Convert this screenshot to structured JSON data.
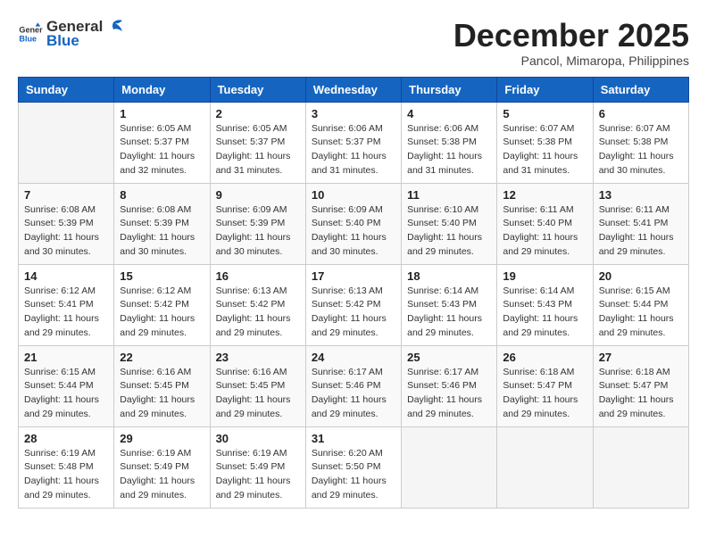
{
  "header": {
    "logo_general": "General",
    "logo_blue": "Blue",
    "month_year": "December 2025",
    "location": "Pancol, Mimaropa, Philippines"
  },
  "weekdays": [
    "Sunday",
    "Monday",
    "Tuesday",
    "Wednesday",
    "Thursday",
    "Friday",
    "Saturday"
  ],
  "weeks": [
    [
      {
        "day": "",
        "sunrise": "",
        "sunset": "",
        "daylight": ""
      },
      {
        "day": "1",
        "sunrise": "Sunrise: 6:05 AM",
        "sunset": "Sunset: 5:37 PM",
        "daylight": "Daylight: 11 hours and 32 minutes."
      },
      {
        "day": "2",
        "sunrise": "Sunrise: 6:05 AM",
        "sunset": "Sunset: 5:37 PM",
        "daylight": "Daylight: 11 hours and 31 minutes."
      },
      {
        "day": "3",
        "sunrise": "Sunrise: 6:06 AM",
        "sunset": "Sunset: 5:37 PM",
        "daylight": "Daylight: 11 hours and 31 minutes."
      },
      {
        "day": "4",
        "sunrise": "Sunrise: 6:06 AM",
        "sunset": "Sunset: 5:38 PM",
        "daylight": "Daylight: 11 hours and 31 minutes."
      },
      {
        "day": "5",
        "sunrise": "Sunrise: 6:07 AM",
        "sunset": "Sunset: 5:38 PM",
        "daylight": "Daylight: 11 hours and 31 minutes."
      },
      {
        "day": "6",
        "sunrise": "Sunrise: 6:07 AM",
        "sunset": "Sunset: 5:38 PM",
        "daylight": "Daylight: 11 hours and 30 minutes."
      }
    ],
    [
      {
        "day": "7",
        "sunrise": "Sunrise: 6:08 AM",
        "sunset": "Sunset: 5:39 PM",
        "daylight": "Daylight: 11 hours and 30 minutes."
      },
      {
        "day": "8",
        "sunrise": "Sunrise: 6:08 AM",
        "sunset": "Sunset: 5:39 PM",
        "daylight": "Daylight: 11 hours and 30 minutes."
      },
      {
        "day": "9",
        "sunrise": "Sunrise: 6:09 AM",
        "sunset": "Sunset: 5:39 PM",
        "daylight": "Daylight: 11 hours and 30 minutes."
      },
      {
        "day": "10",
        "sunrise": "Sunrise: 6:09 AM",
        "sunset": "Sunset: 5:40 PM",
        "daylight": "Daylight: 11 hours and 30 minutes."
      },
      {
        "day": "11",
        "sunrise": "Sunrise: 6:10 AM",
        "sunset": "Sunset: 5:40 PM",
        "daylight": "Daylight: 11 hours and 29 minutes."
      },
      {
        "day": "12",
        "sunrise": "Sunrise: 6:11 AM",
        "sunset": "Sunset: 5:40 PM",
        "daylight": "Daylight: 11 hours and 29 minutes."
      },
      {
        "day": "13",
        "sunrise": "Sunrise: 6:11 AM",
        "sunset": "Sunset: 5:41 PM",
        "daylight": "Daylight: 11 hours and 29 minutes."
      }
    ],
    [
      {
        "day": "14",
        "sunrise": "Sunrise: 6:12 AM",
        "sunset": "Sunset: 5:41 PM",
        "daylight": "Daylight: 11 hours and 29 minutes."
      },
      {
        "day": "15",
        "sunrise": "Sunrise: 6:12 AM",
        "sunset": "Sunset: 5:42 PM",
        "daylight": "Daylight: 11 hours and 29 minutes."
      },
      {
        "day": "16",
        "sunrise": "Sunrise: 6:13 AM",
        "sunset": "Sunset: 5:42 PM",
        "daylight": "Daylight: 11 hours and 29 minutes."
      },
      {
        "day": "17",
        "sunrise": "Sunrise: 6:13 AM",
        "sunset": "Sunset: 5:42 PM",
        "daylight": "Daylight: 11 hours and 29 minutes."
      },
      {
        "day": "18",
        "sunrise": "Sunrise: 6:14 AM",
        "sunset": "Sunset: 5:43 PM",
        "daylight": "Daylight: 11 hours and 29 minutes."
      },
      {
        "day": "19",
        "sunrise": "Sunrise: 6:14 AM",
        "sunset": "Sunset: 5:43 PM",
        "daylight": "Daylight: 11 hours and 29 minutes."
      },
      {
        "day": "20",
        "sunrise": "Sunrise: 6:15 AM",
        "sunset": "Sunset: 5:44 PM",
        "daylight": "Daylight: 11 hours and 29 minutes."
      }
    ],
    [
      {
        "day": "21",
        "sunrise": "Sunrise: 6:15 AM",
        "sunset": "Sunset: 5:44 PM",
        "daylight": "Daylight: 11 hours and 29 minutes."
      },
      {
        "day": "22",
        "sunrise": "Sunrise: 6:16 AM",
        "sunset": "Sunset: 5:45 PM",
        "daylight": "Daylight: 11 hours and 29 minutes."
      },
      {
        "day": "23",
        "sunrise": "Sunrise: 6:16 AM",
        "sunset": "Sunset: 5:45 PM",
        "daylight": "Daylight: 11 hours and 29 minutes."
      },
      {
        "day": "24",
        "sunrise": "Sunrise: 6:17 AM",
        "sunset": "Sunset: 5:46 PM",
        "daylight": "Daylight: 11 hours and 29 minutes."
      },
      {
        "day": "25",
        "sunrise": "Sunrise: 6:17 AM",
        "sunset": "Sunset: 5:46 PM",
        "daylight": "Daylight: 11 hours and 29 minutes."
      },
      {
        "day": "26",
        "sunrise": "Sunrise: 6:18 AM",
        "sunset": "Sunset: 5:47 PM",
        "daylight": "Daylight: 11 hours and 29 minutes."
      },
      {
        "day": "27",
        "sunrise": "Sunrise: 6:18 AM",
        "sunset": "Sunset: 5:47 PM",
        "daylight": "Daylight: 11 hours and 29 minutes."
      }
    ],
    [
      {
        "day": "28",
        "sunrise": "Sunrise: 6:19 AM",
        "sunset": "Sunset: 5:48 PM",
        "daylight": "Daylight: 11 hours and 29 minutes."
      },
      {
        "day": "29",
        "sunrise": "Sunrise: 6:19 AM",
        "sunset": "Sunset: 5:49 PM",
        "daylight": "Daylight: 11 hours and 29 minutes."
      },
      {
        "day": "30",
        "sunrise": "Sunrise: 6:19 AM",
        "sunset": "Sunset: 5:49 PM",
        "daylight": "Daylight: 11 hours and 29 minutes."
      },
      {
        "day": "31",
        "sunrise": "Sunrise: 6:20 AM",
        "sunset": "Sunset: 5:50 PM",
        "daylight": "Daylight: 11 hours and 29 minutes."
      },
      {
        "day": "",
        "sunrise": "",
        "sunset": "",
        "daylight": ""
      },
      {
        "day": "",
        "sunrise": "",
        "sunset": "",
        "daylight": ""
      },
      {
        "day": "",
        "sunrise": "",
        "sunset": "",
        "daylight": ""
      }
    ]
  ]
}
